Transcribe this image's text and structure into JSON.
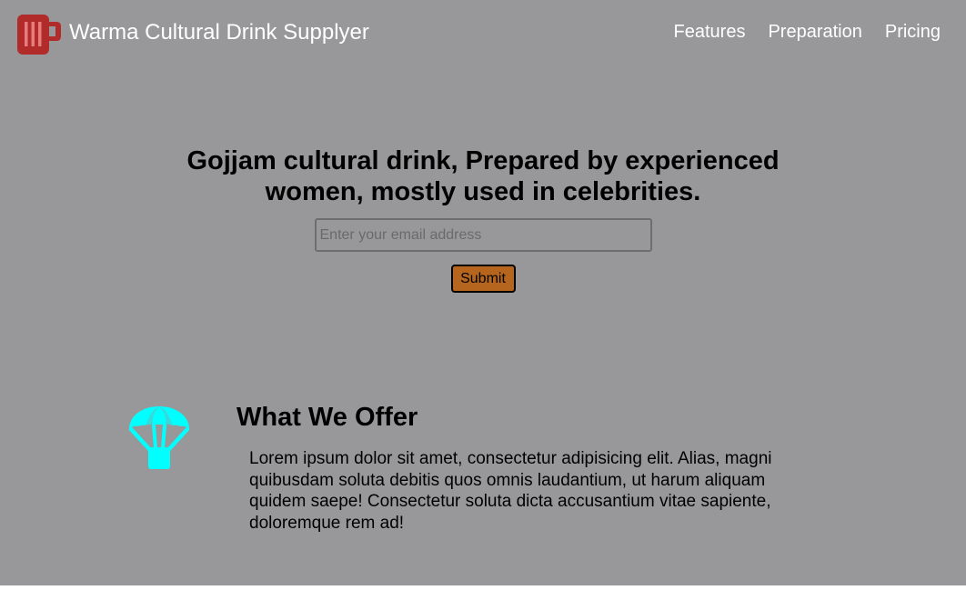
{
  "header": {
    "logo_icon": "mug-icon",
    "brand_name": "Warma Cultural Drink Supplyer",
    "nav": [
      {
        "label": "Features"
      },
      {
        "label": "Preparation"
      },
      {
        "label": "Pricing"
      }
    ]
  },
  "hero": {
    "title": "Gojjam cultural drink, Prepared by experienced women, mostly used in celebrities.",
    "email_placeholder": "Enter your email address",
    "submit_label": "Submit"
  },
  "offer": {
    "icon": "parachute-icon",
    "title": "What We Offer",
    "text": "Lorem ipsum dolor sit amet, consectetur adipisicing elit. Alias, magni quibusdam soluta debitis quos omnis laudantium, ut harum aliquam quidem saepe! Consectetur soluta dicta accusantium vitae sapiente, doloremque rem ad!"
  },
  "colors": {
    "background": "#98989a",
    "logo": "#b22b2b",
    "accent_icon": "#00ffff",
    "button": "#b5651d",
    "nav_text": "#ffffff"
  }
}
